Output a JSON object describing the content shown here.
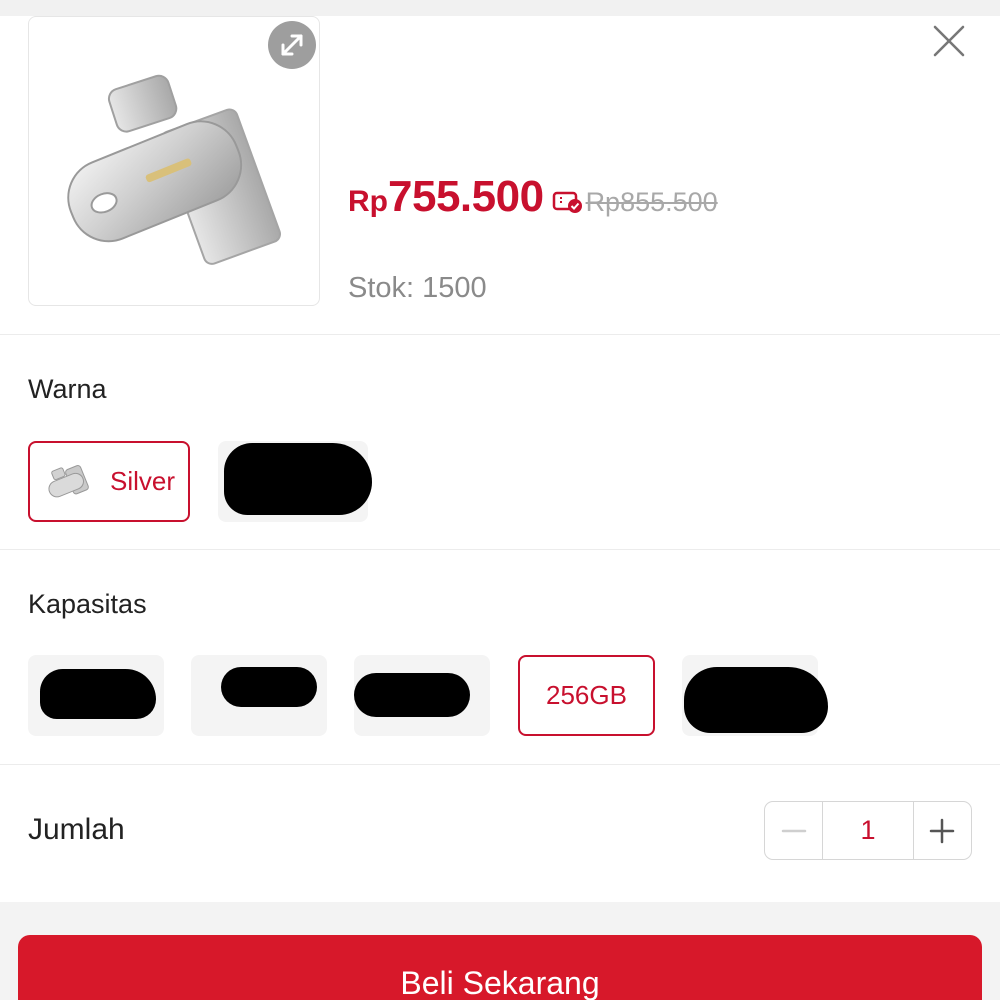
{
  "product": {
    "image_alt": "SanDisk Ultra Dual Drive Luxe USB flash drive",
    "price_prefix": "Rp",
    "price": "755.500",
    "price_original": "Rp855.500",
    "stock": "Stok: 1500"
  },
  "variants": {
    "color": {
      "label": "Warna",
      "options": [
        {
          "label": "Silver",
          "selected": true
        },
        {
          "label": "",
          "redacted": true
        }
      ]
    },
    "capacity": {
      "label": "Kapasitas",
      "options": [
        {
          "label": "",
          "redacted": true
        },
        {
          "label": "",
          "redacted": true
        },
        {
          "label": "",
          "redacted": true
        },
        {
          "label": "256GB",
          "selected": true
        },
        {
          "label": "",
          "redacted": true
        }
      ]
    }
  },
  "quantity": {
    "label": "Jumlah",
    "value": "1",
    "decrement_icon": "minus-icon",
    "increment_icon": "plus-icon"
  },
  "actions": {
    "buy_now": "Beli Sekarang",
    "close_icon": "close-icon",
    "expand_icon": "expand-icon"
  },
  "colors": {
    "accent": "#c8102e",
    "button": "#d7182a",
    "muted_text": "#8a8a8a"
  }
}
